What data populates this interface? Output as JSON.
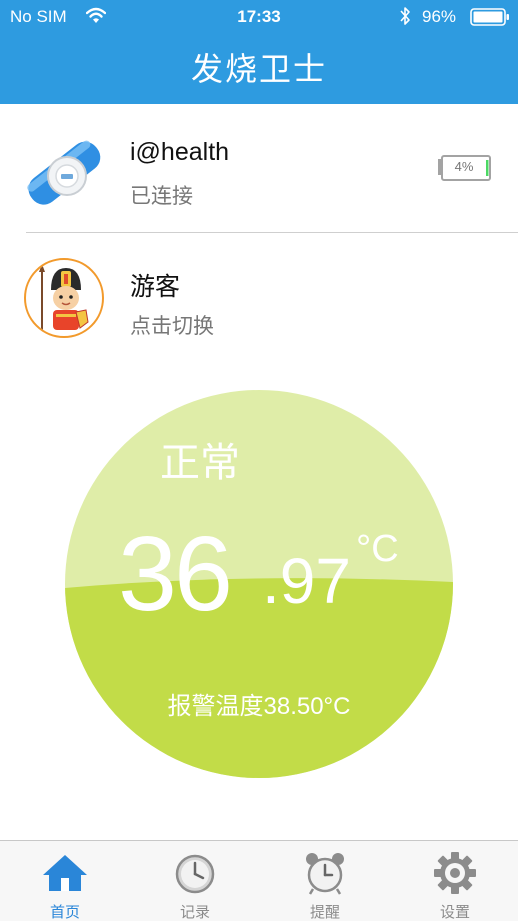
{
  "status_bar": {
    "carrier": "No SIM",
    "time": "17:33",
    "battery": "96%"
  },
  "header": {
    "title": "发烧卫士"
  },
  "device": {
    "name": "i@health",
    "status": "已连接",
    "battery": "4%",
    "battery_level": 0.04
  },
  "user": {
    "name": "游客",
    "action": "点击切换"
  },
  "temperature": {
    "status": "正常",
    "integer": "36",
    "fraction": ".97",
    "unit": "°C",
    "alarm": "报警温度38.50°C"
  },
  "tabs": [
    {
      "label": "首页",
      "icon": "home-icon",
      "active": true
    },
    {
      "label": "记录",
      "icon": "clock-icon",
      "active": false
    },
    {
      "label": "提醒",
      "icon": "alarm-clock-icon",
      "active": false
    },
    {
      "label": "设置",
      "icon": "gear-icon",
      "active": false
    }
  ],
  "colors": {
    "header": "#2e9be0",
    "dial_light": "#dfeda8",
    "dial_dark": "#c2dc48",
    "tab_active": "#2a86d8",
    "tab_inactive": "#8c8c8c",
    "battery_low": "#4cd964"
  }
}
